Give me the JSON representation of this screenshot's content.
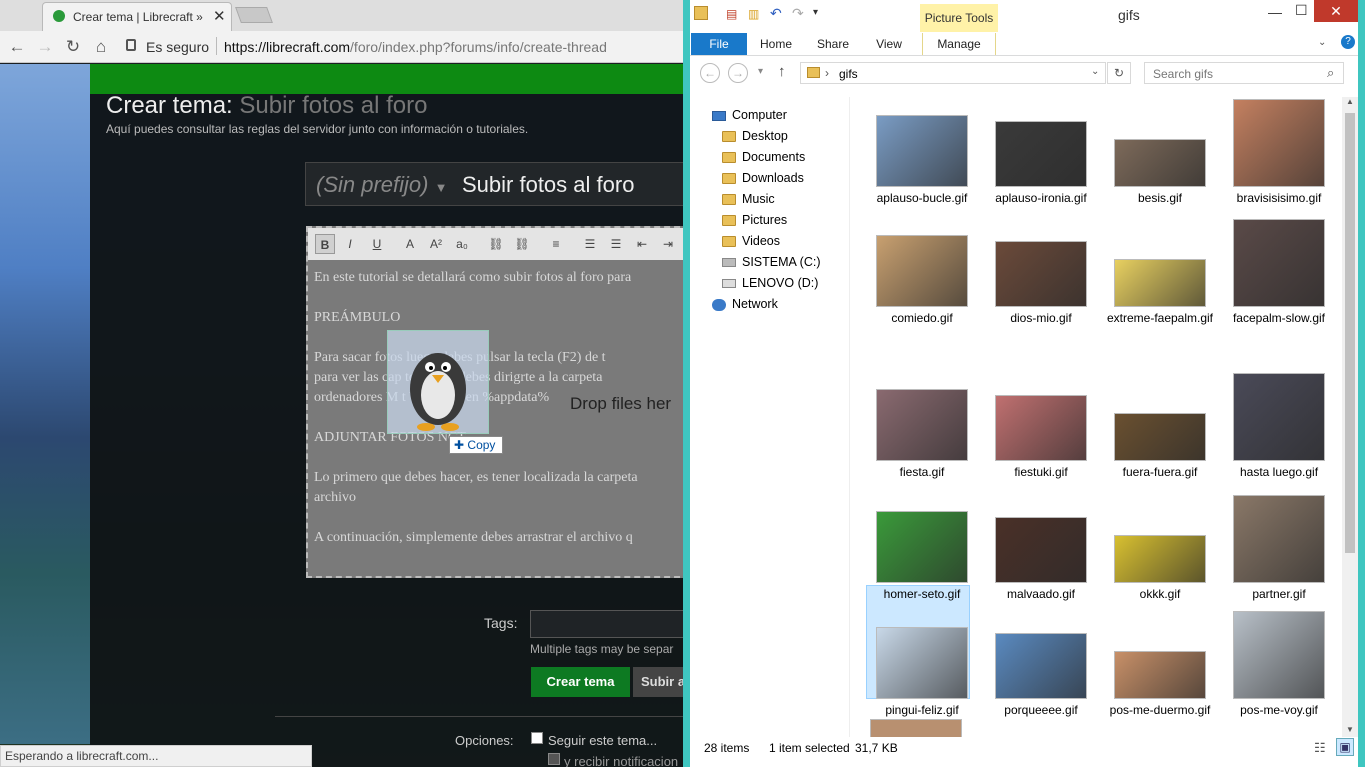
{
  "chrome": {
    "tab_title": "Crear tema | Librecraft »",
    "secure_label": "Es seguro",
    "url_base": "https://librecraft.com",
    "url_path": "/foro/index.php?forums/info/create-thread",
    "status": "Esperando a librecraft.com..."
  },
  "forum": {
    "heading_prefix": "Crear tema:",
    "heading_title": "Subir fotos al foro",
    "subtitle": "Aquí puedes consultar las reglas del servidor junto con información o tutoriales.",
    "prefix_select": "(Sin prefijo)",
    "thread_title": "Subir fotos al foro",
    "editor_tools": [
      "B",
      "I",
      "U",
      "A",
      "A²",
      "a₀",
      "⛓",
      "⛓",
      "≡",
      "☰",
      "☰",
      "⇤",
      "⇥"
    ],
    "editor_lines": [
      "En este tutorial se detallará como subir fotos al foro para",
      "PREÁMBULO",
      "Para sacar fotos       luego debes pulsar la tecla (F2) de t",
      "para ver las cap      tomadas, debes dirigrte a la carpeta",
      "ordenadores M       t Windows en %appdata%",
      "ADJUNTAR FOTOS     NCT",
      "Lo primero que debes hacer, es tener localizada la carpeta",
      "archivo",
      "A continuación, simplemente debes arrastrar el archivo q"
    ],
    "drop_text": "Drop files her",
    "copy_label": "Copy",
    "tags_label": "Tags:",
    "tags_hint": "Multiple tags may be separ",
    "create_button": "Crear tema",
    "upload_button": "Subir a",
    "options_label": "Opciones:",
    "follow_label": "Seguir este tema...",
    "notify_label": "y recibir notificacion"
  },
  "explorer": {
    "context_tab": "Picture Tools",
    "window_title": "gifs",
    "ribbon_tabs": [
      "File",
      "Home",
      "Share",
      "View",
      "Manage"
    ],
    "path": "gifs",
    "search_placeholder": "Search gifs",
    "tree": [
      "Computer",
      "Desktop",
      "Documents",
      "Downloads",
      "Music",
      "Pictures",
      "Videos",
      "SISTEMA (C:)",
      "LENOVO (D:)",
      "Network"
    ],
    "files": [
      {
        "name": "aplauso-bucle.gif",
        "color": "#7a9cc4"
      },
      {
        "name": "aplauso-ironia.gif",
        "color": "#3a3a3a"
      },
      {
        "name": "besis.gif",
        "color": "#7d6a5a"
      },
      {
        "name": "bravisisisimo.gif",
        "color": "#c48060"
      },
      {
        "name": "comiedo.gif",
        "color": "#c8a070"
      },
      {
        "name": "dios-mio.gif",
        "color": "#6b4a3a"
      },
      {
        "name": "extreme-faepalm.gif",
        "color": "#e8d060"
      },
      {
        "name": "facepalm-slow.gif",
        "color": "#5a4a48"
      },
      {
        "name": "fiesta.gif",
        "color": "#8a6a70"
      },
      {
        "name": "fiestuki.gif",
        "color": "#c07070"
      },
      {
        "name": "fuera-fuera.gif",
        "color": "#6a5030"
      },
      {
        "name": "hasta luego.gif",
        "color": "#4a4a58"
      },
      {
        "name": "homer-seto.gif",
        "color": "#3a9a3a"
      },
      {
        "name": "malvaado.gif",
        "color": "#4a3028"
      },
      {
        "name": "okkk.gif",
        "color": "#d8c030"
      },
      {
        "name": "partner.gif",
        "color": "#8a7868"
      },
      {
        "name": "pingui-feliz.gif",
        "color": "#c8d8e8"
      },
      {
        "name": "porqueeee.gif",
        "color": "#5a8ac0"
      },
      {
        "name": "pos-me-duermo.gif",
        "color": "#c89068"
      },
      {
        "name": "pos-me-voy.gif",
        "color": "#b8c0c8"
      }
    ],
    "item_count": "28 items",
    "selected": "1 item selected",
    "size": "31,7 KB"
  }
}
